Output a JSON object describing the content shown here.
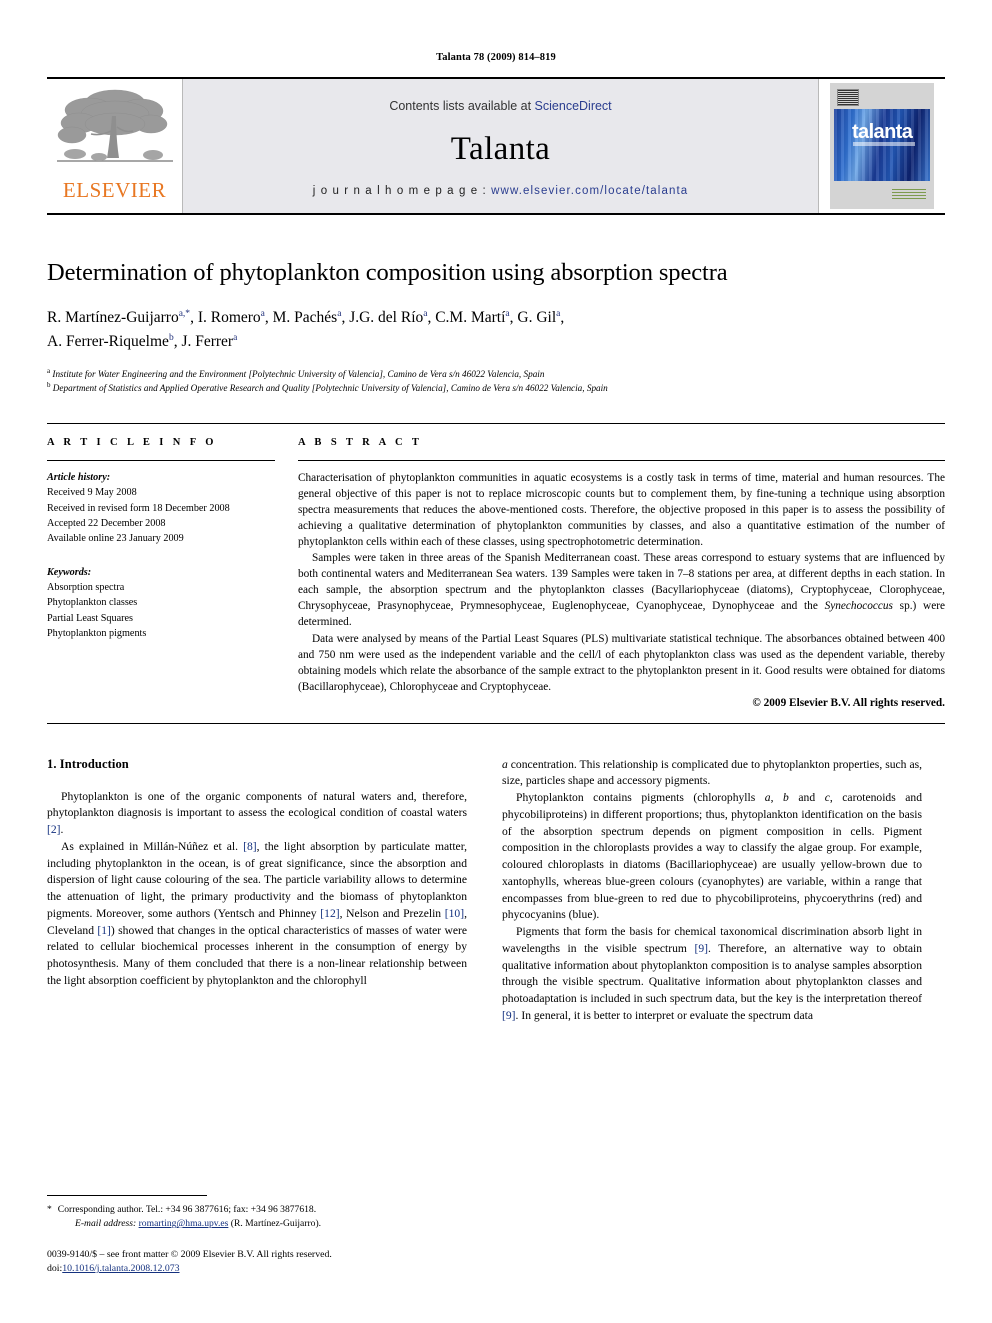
{
  "running_head": "Talanta 78 (2009) 814–819",
  "masthead": {
    "publisher_logo_name": "elsevier-tree-logo",
    "publisher_wordmark": "ELSEVIER",
    "contents_prefix": "Contents lists available at ",
    "contents_link": "ScienceDirect",
    "journal_name": "Talanta",
    "homepage_prefix": "j o u r n a l   h o m e p a g e :  ",
    "homepage_url": "www.elsevier.com/locate/talanta",
    "cover_title": "talanta",
    "accent_link_color": "#2a3d8f",
    "elsevier_orange": "#E87722"
  },
  "article": {
    "title": "Determination of phytoplankton composition using absorption spectra",
    "authors_line1": "R. Martínez-Guijarro",
    "authors_html_line1": "R. Martínez-Guijarro<sup>a,*</sup>, I. Romero<sup>a</sup>, M. Pachés<sup>a</sup>, J.G. del Río<sup>a</sup>, C.M. Martí<sup>a</sup>, G. Gil<sup>a</sup>,",
    "authors_html_line2": "A. Ferrer-Riquelme<sup>b</sup>, J. Ferrer<sup>a</sup>",
    "affiliation_a": "Institute for Water Engineering and the Environment [Polytechnic University of Valencia], Camino de Vera s/n 46022 Valencia, Spain",
    "affiliation_b": "Department of Statistics and Applied Operative Research and Quality [Polytechnic University of Valencia], Camino de Vera s/n 46022 Valencia, Spain"
  },
  "article_info": {
    "heading": "A R T I C L E   I N F O",
    "history_label": "Article history:",
    "history": [
      "Received 9 May 2008",
      "Received in revised form 18 December 2008",
      "Accepted 22 December 2008",
      "Available online 23 January 2009"
    ],
    "keywords_label": "Keywords:",
    "keywords": [
      "Absorption spectra",
      "Phytoplankton classes",
      "Partial Least Squares",
      "Phytoplankton pigments"
    ]
  },
  "abstract": {
    "heading": "A B S T R A C T",
    "paragraphs": [
      "Characterisation of phytoplankton communities in aquatic ecosystems is a costly task in terms of time, material and human resources. The general objective of this paper is not to replace microscopic counts but to complement them, by fine-tuning a technique using absorption spectra measurements that reduces the above-mentioned costs. Therefore, the objective proposed in this paper is to assess the possibility of achieving a qualitative determination of phytoplankton communities by classes, and also a quantitative estimation of the number of phytoplankton cells within each of these classes, using spectrophotometric determination.",
      "Samples were taken in three areas of the Spanish Mediterranean coast. These areas correspond to estuary systems that are influenced by both continental waters and Mediterranean Sea waters. 139 Samples were taken in 7–8 stations per area, at different depths in each station. In each sample, the absorption spectrum and the phytoplankton classes (Bacyllariophyceae (diatoms), Cryptophyceae, Clorophyceae, Chrysophyceae, Prasynophyceae, Prymnesophyceae, Euglenophyceae, Cyanophyceae, Dynophyceae and the Synechococcus sp.) were determined.",
      "Data were analysed by means of the Partial Least Squares (PLS) multivariate statistical technique. The absorbances obtained between 400 and 750 nm were used as the independent variable and the cell/l of each phytoplankton class was used as the dependent variable, thereby obtaining models which relate the absorbance of the sample extract to the phytoplankton present in it. Good results were obtained for diatoms (Bacillarophyceae), Chlorophyceae and Cryptophyceae."
    ],
    "italic_term": "Synechococcus",
    "copyright": "© 2009 Elsevier B.V. All rights reserved."
  },
  "body": {
    "section_number_title": "1.  Introduction",
    "left_paragraphs": [
      "Phytoplankton is one of the organic components of natural waters and, therefore, phytoplankton diagnosis is important to assess the ecological condition of coastal waters [2].",
      "As explained in Millán-Núñez et al. [8], the light absorption by particulate matter, including phytoplankton in the ocean, is of great significance, since the absorption and dispersion of light cause colouring of the sea. The particle variability allows to determine the attenuation of light, the primary productivity and the biomass of phytoplankton pigments. Moreover, some authors (Yentsch and Phinney [12], Nelson and Prezelin [10], Cleveland [1]) showed that changes in the optical characteristics of masses of water were related to cellular biochemical processes inherent in the consumption of energy by photosynthesis. Many of them concluded that there is a non-linear relationship between the light absorption coefficient by phytoplankton and the chlorophyll"
    ],
    "right_paragraphs": [
      "a concentration. This relationship is complicated due to phytoplankton properties, such as, size, particles shape and accessory pigments.",
      "Phytoplankton contains pigments (chlorophylls a, b and c, carotenoids and phycobiliproteins) in different proportions; thus, phytoplankton identification on the basis of the absorption spectrum depends on pigment composition in cells. Pigment composition in the chloroplasts provides a way to classify the algae group. For example, coloured chloroplasts in diatoms (Bacillariophyceae) are usually yellow-brown due to xantophylls, whereas blue-green colours (cyanophytes) are variable, within a range that encompasses from blue-green to red due to phycobiliproteins, phycoerythrins (red) and phycocyanins (blue).",
      "Pigments that form the basis for chemical taxonomical discrimination absorb light in wavelengths in the visible spectrum [9]. Therefore, an alternative way to obtain qualitative information about phytoplankton composition is to analyse samples absorption through the visible spectrum. Qualitative information about phytoplankton classes and photoadaptation is included in such spectrum data, but the key is the interpretation thereof [9]. In general, it is better to interpret or evaluate the spectrum data"
    ],
    "reference_marks": [
      "[2]",
      "[8]",
      "[12]",
      "[10]",
      "[1]",
      "[9]"
    ],
    "reference_color": "#14317f"
  },
  "footnotes": {
    "corresponding_star": "*",
    "corresponding_text": "Corresponding author. Tel.: +34 96 3877616; fax: +34 96 3877618.",
    "email_label": "E-mail address:",
    "email": "romarting@hma.upv.es",
    "email_owner": "(R. Martínez-Guijarro).",
    "issn_line": "0039-9140/$ – see front matter © 2009 Elsevier B.V. All rights reserved.",
    "doi_label": "doi:",
    "doi": "10.1016/j.talanta.2008.12.073"
  }
}
